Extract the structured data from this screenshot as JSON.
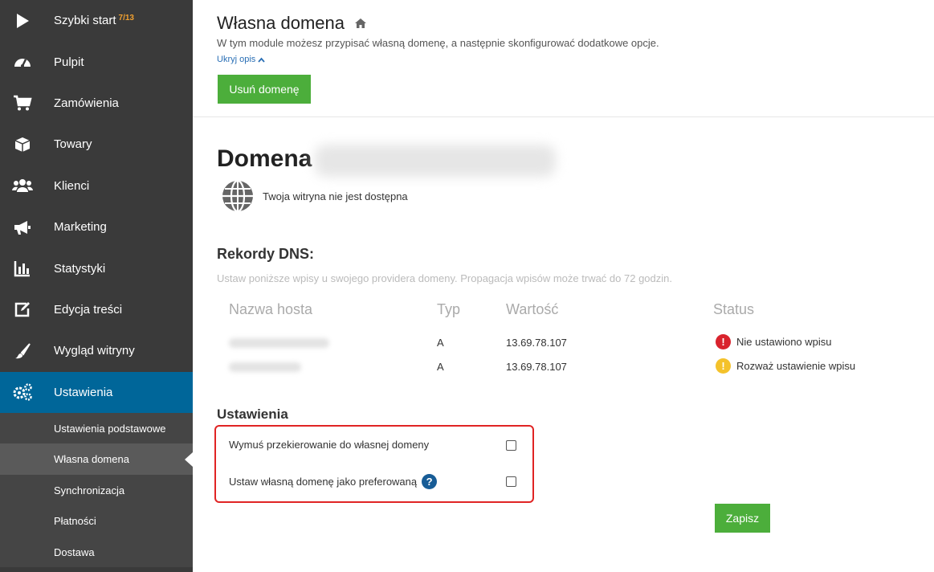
{
  "sidebar": {
    "items": [
      {
        "label": "Szybki start",
        "badge": "7/13",
        "icon": "play-icon"
      },
      {
        "label": "Pulpit",
        "icon": "dashboard-icon"
      },
      {
        "label": "Zamówienia",
        "icon": "cart-icon"
      },
      {
        "label": "Towary",
        "icon": "box-icon"
      },
      {
        "label": "Klienci",
        "icon": "users-icon"
      },
      {
        "label": "Marketing",
        "icon": "megaphone-icon"
      },
      {
        "label": "Statystyki",
        "icon": "bar-chart-icon"
      },
      {
        "label": "Edycja treści",
        "icon": "edit-icon"
      },
      {
        "label": "Wygląd witryny",
        "icon": "brush-icon"
      },
      {
        "label": "Ustawienia",
        "icon": "gears-icon"
      }
    ],
    "subitems": [
      {
        "label": "Ustawienia podstawowe"
      },
      {
        "label": "Własna domena"
      },
      {
        "label": "Synchronizacja"
      },
      {
        "label": "Płatności"
      },
      {
        "label": "Dostawa"
      }
    ],
    "active_color": "#006699"
  },
  "header": {
    "title": "Własna domena",
    "description": "W tym module możesz przypisać własną domenę, a następnie skonfigurować dodatkowe opcje.",
    "hide_link": "Ukryj opis",
    "remove_button": "Usuń domenę"
  },
  "domain": {
    "title": "Domena",
    "status": "Twoja witryna nie jest dostępna"
  },
  "dns": {
    "title": "Rekordy DNS:",
    "description": "Ustaw poniższe wpisy u swojego providera domeny. Propagacja wpisów może trwać do 72 godzin.",
    "columns": [
      "Nazwa hosta",
      "Typ",
      "Wartość",
      "Status"
    ],
    "rows": [
      {
        "type": "A",
        "value": "13.69.78.107",
        "status": "Nie ustawiono wpisu",
        "status_color": "#d9232d"
      },
      {
        "type": "A",
        "value": "13.69.78.107",
        "status": "Rozważ ustawienie wpisu",
        "status_color": "#f4c22b"
      }
    ]
  },
  "settings": {
    "title": "Ustawienia",
    "options": [
      {
        "label": "Wymuś przekierowanie do własnej domeny",
        "checked": false
      },
      {
        "label": "Ustaw własną domenę jako preferowaną",
        "checked": false,
        "help": "?"
      }
    ],
    "save_button": "Zapisz"
  },
  "colors": {
    "green": "#4cae3b",
    "sidebar_bg": "#3a3a3a",
    "highlight_border": "#e02424"
  }
}
